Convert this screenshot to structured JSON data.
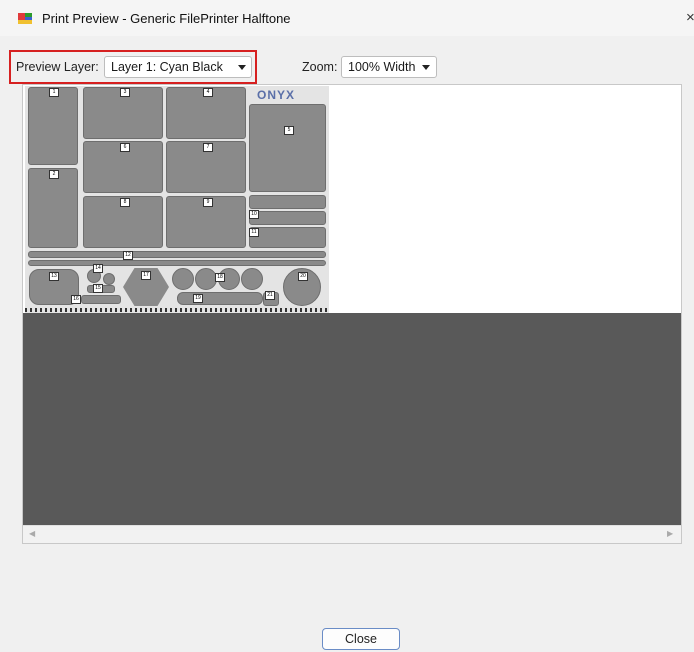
{
  "window": {
    "title": "Print Preview - Generic FilePrinter Halftone",
    "close_glyph": "×",
    "icon": "app-color-icon",
    "icon_colors": [
      "#e03a3a",
      "#2b9a2b",
      "#3a5fd0",
      "#f0c030"
    ]
  },
  "toolbar": {
    "preview_layer_label": "Preview Layer:",
    "preview_layer_value": "Layer 1: Cyan Black",
    "zoom_label": "Zoom:",
    "zoom_value": "100% Width",
    "highlight_color": "#d62020"
  },
  "preview": {
    "logo_text": "ONYX",
    "tile_numbers": [
      "1",
      "2",
      "3",
      "4",
      "5",
      "6",
      "7",
      "8",
      "9",
      "10",
      "11",
      "12",
      "13",
      "14",
      "15",
      "16",
      "17",
      "18",
      "19",
      "20",
      "21"
    ]
  },
  "footer": {
    "close_label": "Close"
  }
}
